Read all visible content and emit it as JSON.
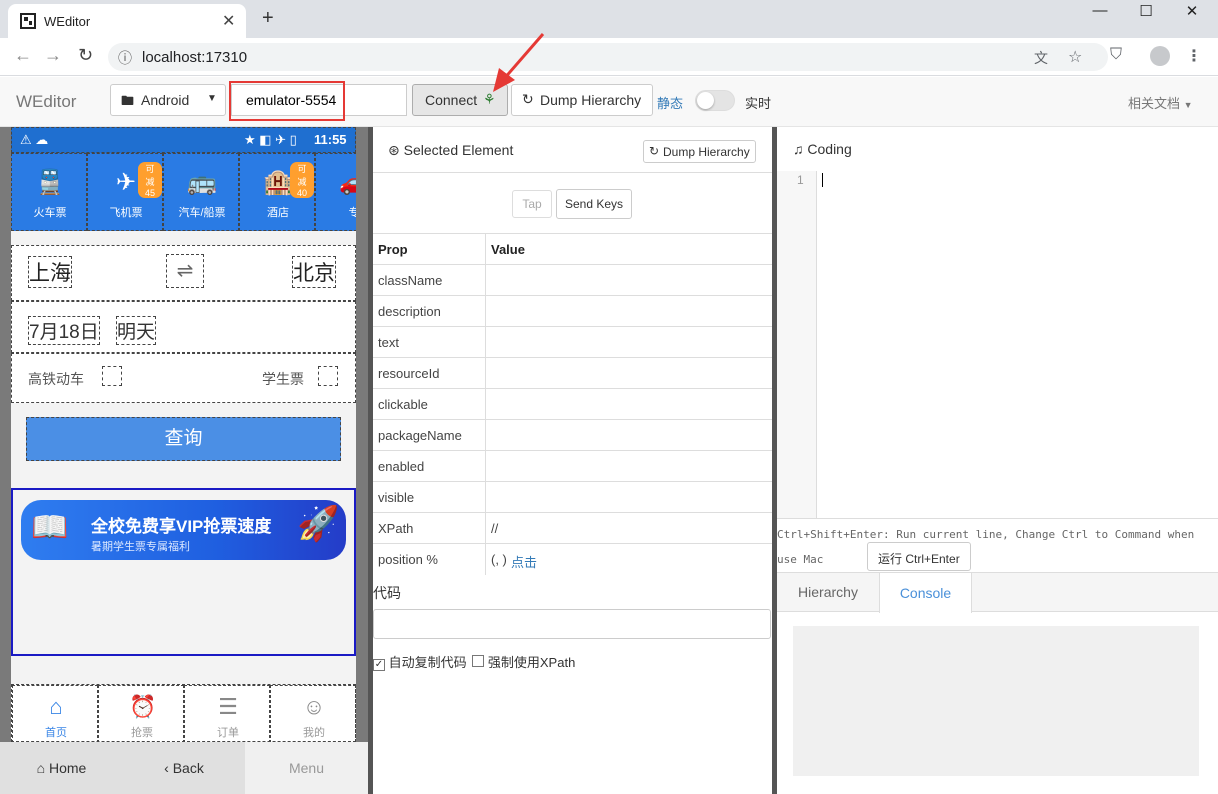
{
  "browser": {
    "tab_title": "WEditor",
    "url": "localhost:17310",
    "new_tab": "+",
    "win_min": "—",
    "win_max": "☐",
    "win_close": "✕"
  },
  "toolbar": {
    "brand": "WEditor",
    "platform": "Android",
    "serial_value": "emulator-5554",
    "connect_label": "Connect",
    "dump_label": "Dump Hierarchy",
    "static_label": "静态",
    "realtime_label": "实时",
    "docs_label": "相关文档"
  },
  "phone": {
    "status_time": "11:55",
    "categories": [
      {
        "label": "火车票",
        "icon": "train-icon",
        "glyph": "🚆",
        "badge": ""
      },
      {
        "label": "飞机票",
        "icon": "plane-icon",
        "glyph": "✈",
        "badge": "可减45"
      },
      {
        "label": "汽车/船票",
        "icon": "bus-icon",
        "glyph": "🚌",
        "badge": ""
      },
      {
        "label": "酒店",
        "icon": "hotel-icon",
        "glyph": "🏨",
        "badge": "可减40"
      },
      {
        "label": "专",
        "icon": "car-icon",
        "glyph": "🚗",
        "badge": ""
      }
    ],
    "from_city": "上海",
    "swap": "⇌",
    "to_city": "北京",
    "date": "7月18日",
    "date_suffix": "明天",
    "opt_highspeed": "高铁动车",
    "opt_student": "学生票",
    "search_label": "查询",
    "banner_title": "全校免费享VIP抢票速度",
    "banner_sub": "暑期学生票专属福利",
    "tabs": [
      {
        "label": "首页",
        "icon": "home-icon",
        "glyph": "⌂",
        "active": true
      },
      {
        "label": "抢票",
        "icon": "clock-icon",
        "glyph": "⏰",
        "active": false
      },
      {
        "label": "订单",
        "icon": "order-icon",
        "glyph": "☰",
        "active": false
      },
      {
        "label": "我的",
        "icon": "user-icon",
        "glyph": "☺",
        "active": false
      }
    ],
    "nav_home": "Home",
    "nav_back": "Back",
    "nav_menu": "Menu"
  },
  "inspector": {
    "title": "Selected Element",
    "dump_label": "Dump Hierarchy",
    "tap_label": "Tap",
    "sendkeys_label": "Send Keys",
    "col_prop": "Prop",
    "col_value": "Value",
    "props": [
      {
        "k": "className",
        "v": ""
      },
      {
        "k": "description",
        "v": ""
      },
      {
        "k": "text",
        "v": ""
      },
      {
        "k": "resourceId",
        "v": ""
      },
      {
        "k": "clickable",
        "v": ""
      },
      {
        "k": "packageName",
        "v": ""
      },
      {
        "k": "enabled",
        "v": ""
      },
      {
        "k": "visible",
        "v": ""
      },
      {
        "k": "XPath",
        "v": "//"
      },
      {
        "k": "position %",
        "v": "(, )"
      }
    ],
    "position_link": "点击",
    "code_label": "代码",
    "auto_copy": "自动复制代码",
    "force_xpath": "强制使用XPath"
  },
  "editor": {
    "title": "Coding",
    "line_no": "1",
    "hint": "Ctrl+Shift+Enter: Run current line, Change Ctrl to Command when use Mac",
    "run_label": "运行 Ctrl+Enter",
    "tab_hierarchy": "Hierarchy",
    "tab_console": "Console"
  }
}
